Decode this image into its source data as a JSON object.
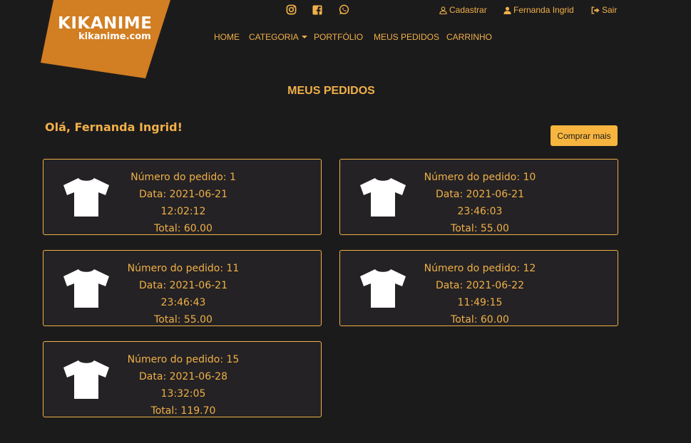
{
  "brand": {
    "title": "KIKANIME",
    "subtitle": "kikanime.com",
    "color": "#d27e22"
  },
  "social": [
    {
      "icon": "instagram-icon"
    },
    {
      "icon": "facebook-icon"
    },
    {
      "icon": "whatsapp-icon"
    }
  ],
  "topnav": {
    "signup": "Cadastrar",
    "user": "Fernanda Ingrid",
    "logout": "Sair"
  },
  "mainnav": {
    "home": "HOME",
    "category": "CATEGORIA",
    "portfolio": "PORTFÓLIO",
    "orders": "MEUS PEDIDOS",
    "cart": "CARRINHO"
  },
  "page": {
    "title": "MEUS PEDIDOS",
    "greeting": "Olá, Fernanda Ingrid!",
    "buy_more": "Comprar mais"
  },
  "orders": [
    {
      "number": "Número do pedido: 1",
      "date": "Data: 2021-06-21 12:02:12",
      "total": "Total: 60.00"
    },
    {
      "number": "Número do pedido: 10",
      "date": "Data: 2021-06-21 23:46:03",
      "total": "Total: 55.00"
    },
    {
      "number": "Número do pedido: 11",
      "date": "Data: 2021-06-21 23:46:43",
      "total": "Total: 55.00"
    },
    {
      "number": "Número do pedido: 12",
      "date": "Data: 2021-06-22 11:49:15",
      "total": "Total: 60.00"
    },
    {
      "number": "Número do pedido: 15",
      "date": "Data: 2021-06-28 13:32:05",
      "total": "Total: 119.70"
    }
  ],
  "colors": {
    "background": "#1c1b1c",
    "accent": "#f0b048",
    "button": "#f7b53f",
    "card": "#242224"
  }
}
